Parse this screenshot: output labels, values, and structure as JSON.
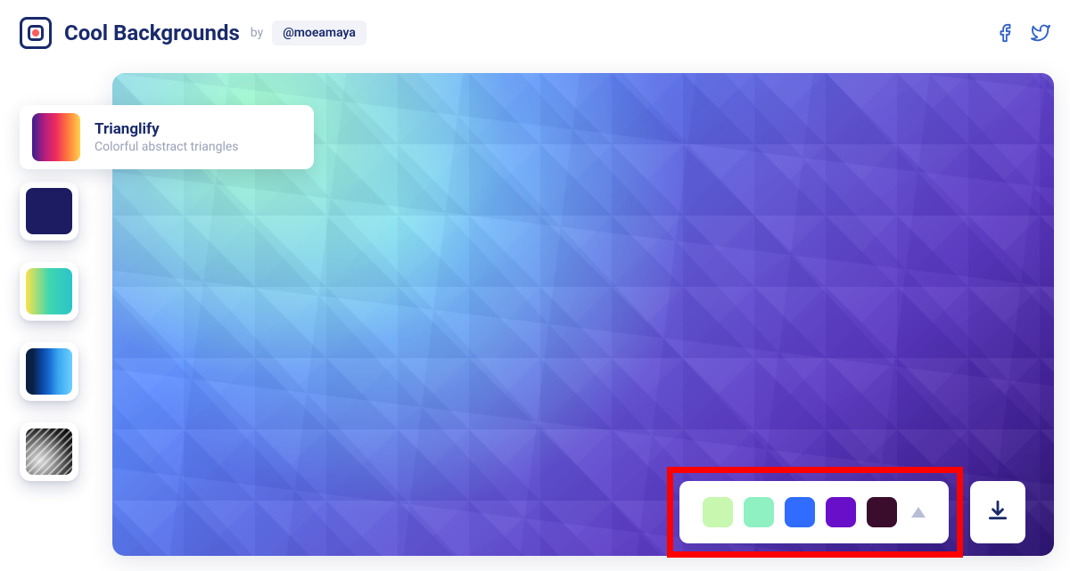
{
  "header": {
    "title": "Cool Backgrounds",
    "by_label": "by",
    "author_handle": "@moeamaya"
  },
  "generator": {
    "name": "Trianglify",
    "subtitle": "Colorful abstract triangles"
  },
  "palette": {
    "swatches": [
      "#c8f7b0",
      "#8ff0c1",
      "#2f6cff",
      "#6a0fc9",
      "#3a0d2d"
    ]
  },
  "sidebar_thumbs": [
    {
      "id": "navy-solid"
    },
    {
      "id": "yellow-teal-gradient"
    },
    {
      "id": "blue-stripes"
    },
    {
      "id": "bw-architecture"
    }
  ],
  "icons": {
    "facebook": "facebook-icon",
    "twitter": "twitter-icon",
    "download": "download-icon",
    "expand_palette": "chevron-up-icon"
  }
}
